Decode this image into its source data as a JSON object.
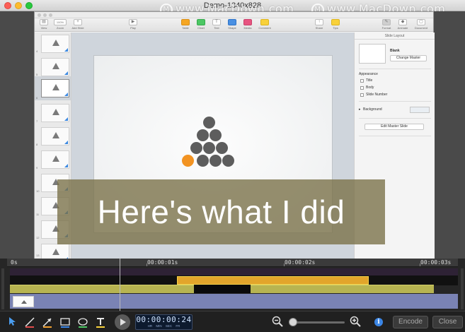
{
  "window": {
    "title": "Demo-1340x828",
    "watermark_left": "www.MacDown.com",
    "watermark_right": "www.MacDown.com",
    "watermark_logo_left": "M",
    "watermark_logo_right": "M"
  },
  "keynote": {
    "toolbar": {
      "view": "View",
      "zoom_value": "100%",
      "zoom": "Zoom",
      "add_slide": "Add Slide",
      "play": "Play",
      "table": "Table",
      "chart": "Chart",
      "text": "Text",
      "shape": "Shape",
      "media": "Media",
      "comment": "Comment",
      "share": "Share",
      "tips": "Tips",
      "format": "Format",
      "animate": "Animate",
      "document": "Document"
    },
    "slide_numbers": [
      "4",
      "5",
      "6",
      "7",
      "8",
      "9",
      "10",
      "11",
      "12",
      "13"
    ],
    "inspector": {
      "header": "Slide Layout",
      "master_name": "Blank",
      "change_master": "Change Master",
      "appearance": "Appearance",
      "title": "Title",
      "body": "Body",
      "slide_number": "Slide Number",
      "background": "Background",
      "edit_master": "Edit Master Slide"
    }
  },
  "caption": {
    "text": "Here's what I did"
  },
  "timeline": {
    "ticks": [
      "0s",
      "00:00:01s",
      "00:00:02s",
      "00:00:03s"
    ]
  },
  "bottombar": {
    "timecode": "00:00:00:24",
    "units": [
      "HR",
      "MIN",
      "SEC",
      "FR"
    ],
    "encode": "Encode",
    "close": "Close"
  },
  "colors": {
    "accent_orange": "#f29322",
    "clip_orange": "#e2a52b",
    "clip_yellow": "#b7b451",
    "video_track": "#7a83b4",
    "info_blue": "#3b86e6"
  }
}
